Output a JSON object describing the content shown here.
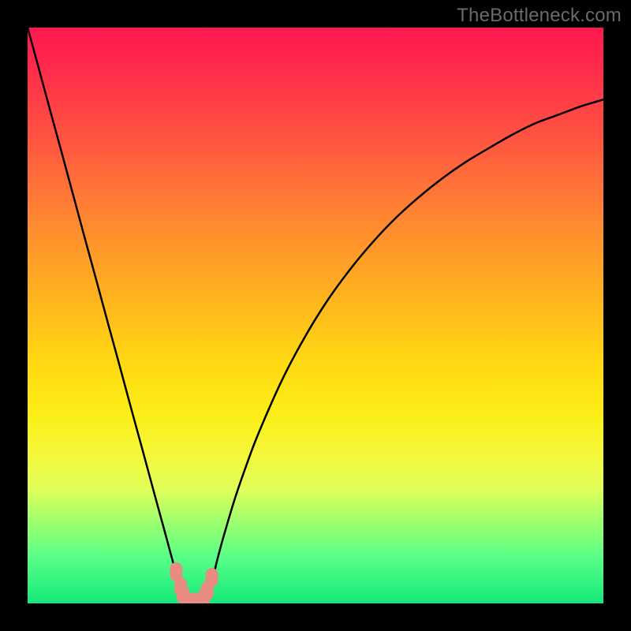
{
  "watermark": "TheBottleneck.com",
  "colors": {
    "frame": "#000000",
    "curve_stroke": "#000000",
    "marker_fill": "#e88b82"
  },
  "chart_data": {
    "type": "line",
    "title": "",
    "xlabel": "",
    "ylabel": "",
    "xlim": [
      0,
      100
    ],
    "ylim": [
      0,
      100
    ],
    "x": [
      0,
      2,
      4,
      6,
      8,
      10,
      12,
      14,
      16,
      18,
      20,
      22,
      24,
      26,
      27,
      28,
      29,
      30,
      31,
      32,
      33,
      34,
      36,
      38,
      40,
      44,
      48,
      52,
      56,
      60,
      64,
      68,
      72,
      76,
      80,
      84,
      88,
      92,
      96,
      100
    ],
    "values": [
      100,
      92.7,
      85.3,
      78.0,
      70.6,
      63.2,
      55.9,
      48.5,
      41.2,
      33.8,
      26.5,
      19.1,
      11.8,
      4.4,
      1.2,
      0.2,
      0.0,
      0.2,
      1.2,
      3.8,
      7.8,
      11.5,
      18.2,
      24.0,
      29.3,
      38.4,
      46.0,
      52.5,
      58.0,
      62.8,
      67.0,
      70.6,
      73.8,
      76.6,
      79.0,
      81.3,
      83.3,
      84.8,
      86.3,
      87.5
    ],
    "markers": {
      "x": [
        25.8,
        26.6,
        27.0,
        28.0,
        29.0,
        30.5,
        31.2,
        32.0
      ],
      "y": [
        5.5,
        2.8,
        1.5,
        0.2,
        0.2,
        0.8,
        2.2,
        4.5
      ]
    },
    "annotations": []
  }
}
